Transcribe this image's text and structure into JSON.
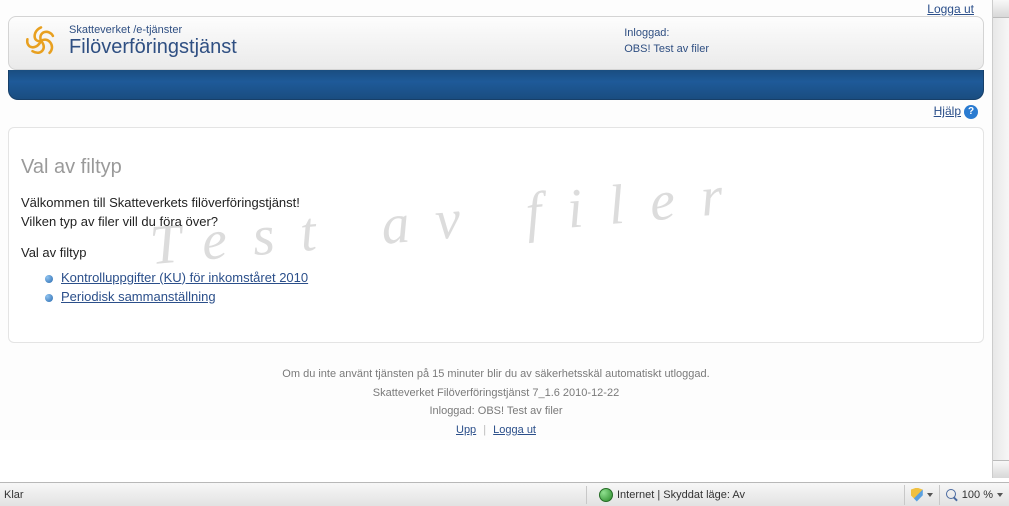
{
  "header": {
    "logout": "Logga ut",
    "brand_small": "Skatteverket /e-tjänster",
    "brand_large": "Filöverföringstjänst",
    "login_label": "Inloggad:",
    "login_value": "OBS! Test av filer"
  },
  "help": {
    "label": "Hjälp"
  },
  "content": {
    "watermark": "Test av filer",
    "title": "Val av filtyp",
    "welcome": "Välkommen till Skatteverkets filöverföringstjänst!",
    "question": "Vilken typ av filer vill du föra över?",
    "subhead": "Val av filtyp",
    "links": [
      "Kontrolluppgifter (KU) för inkomståret 2010",
      "Periodisk sammanställning"
    ]
  },
  "footer": {
    "timeout": "Om du inte använt tjänsten på 15 minuter blir du av säkerhetsskäl automatiskt utloggad.",
    "version": "Skatteverket Filöverföringstjänst 7_1.6 2010-12-22",
    "logged": "Inloggad: OBS! Test av filer",
    "up": "Upp",
    "logout": "Logga ut"
  },
  "statusbar": {
    "left": "Klar",
    "zone": "Internet | Skyddat läge: Av",
    "zoom": "100 %"
  }
}
